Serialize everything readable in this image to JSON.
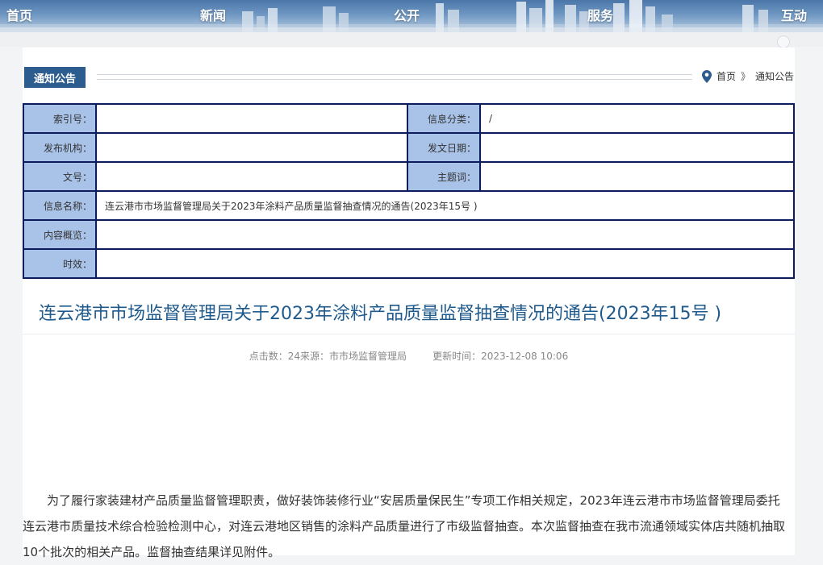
{
  "nav": {
    "items": [
      "首页",
      "新闻",
      "公开",
      "服务",
      "互动"
    ]
  },
  "section": {
    "tag": "通知公告"
  },
  "breadcrumb": {
    "home": "首页",
    "separator": "》",
    "current": "通知公告"
  },
  "info": {
    "index_label": "索引号：",
    "index_value": "",
    "category_label": "信息分类：",
    "category_value": "/",
    "publisher_label": "发布机构：",
    "publisher_value": "",
    "date_label": "发文日期：",
    "date_value": "",
    "docno_label": "文号：",
    "docno_value": "",
    "subject_label": "主题词：",
    "subject_value": "",
    "name_label": "信息名称：",
    "name_value": "连云港市市场监督管理局关于2023年涂料产品质量监督抽查情况的通告(2023年15号 )",
    "summary_label": "内容概览：",
    "summary_value": "",
    "validity_label": "时效：",
    "validity_value": ""
  },
  "article": {
    "title": "连云港市市场监督管理局关于2023年涂料产品质量监督抽查情况的通告(2023年15号 )",
    "meta_left": "点击数：24来源：市市场监督管理局",
    "meta_right": "更新时间：2023-12-08 10:06",
    "paragraph": "为了履行家装建材产品质量监督管理职责，做好装饰装修行业“安居质量保民生”专项工作相关规定，2023年连云港市市场监督管理局委托连云港市质量技术综合检验检测中心，对连云港地区销售的涂料产品质量进行了市级监督抽查。本次监督抽查在我市流通领域实体店共随机抽取10个批次的相关产品。监督抽查结果详见附件。"
  },
  "colors": {
    "nav_blue": "#4a76a8",
    "tag_blue": "#2d5d8f",
    "label_bg": "#a8c2e8",
    "table_border": "#0d1c5c",
    "title_blue": "#1f5a8c"
  }
}
